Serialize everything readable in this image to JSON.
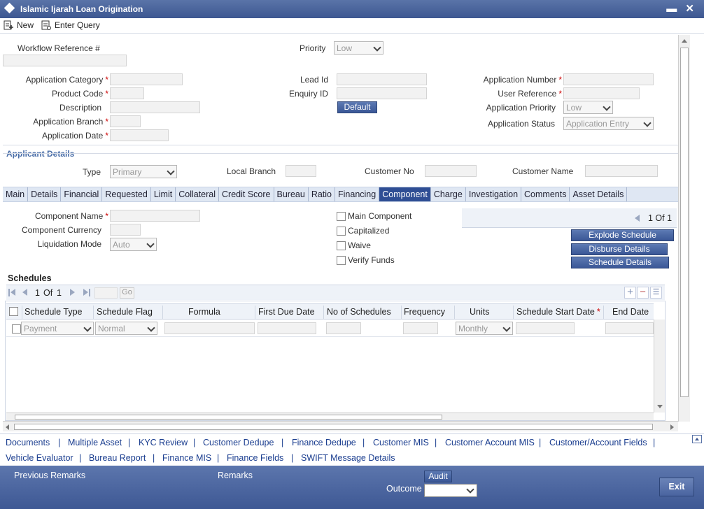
{
  "window": {
    "title": "Islamic Ijarah Loan Origination",
    "controls": "▬ ✕"
  },
  "toolbar": {
    "new": "New",
    "enter_query": "Enter Query"
  },
  "header": {
    "workflow_ref_label": "Workflow Reference #",
    "priority_label": "Priority",
    "priority_value": "Low",
    "app_category_label": "Application Category",
    "product_code_label": "Product Code",
    "description_label": "Description",
    "app_branch_label": "Application Branch",
    "app_date_label": "Application Date",
    "lead_id_label": "Lead Id",
    "enquiry_id_label": "Enquiry ID",
    "default_btn": "Default",
    "app_number_label": "Application Number",
    "user_ref_label": "User Reference",
    "app_priority_label": "Application Priority",
    "app_priority_value": "Low",
    "app_status_label": "Application Status",
    "app_status_value": "Application Entry",
    "required_mark": "*"
  },
  "applicant": {
    "section": "Applicant Details",
    "type_label": "Type",
    "type_value": "Primary",
    "local_branch_label": "Local Branch",
    "customer_no_label": "Customer No",
    "customer_name_label": "Customer Name"
  },
  "tabs": [
    "Main",
    "Details",
    "Financial",
    "Requested",
    "Limit",
    "Collateral",
    "Credit Score",
    "Bureau",
    "Ratio",
    "Financing",
    "Component",
    "Charge",
    "Investigation",
    "Comments",
    "Asset Details"
  ],
  "active_tab": "Component",
  "component": {
    "name_label": "Component Name",
    "currency_label": "Component Currency",
    "liq_mode_label": "Liquidation Mode",
    "liq_mode_value": "Auto",
    "main_component": "Main Component",
    "capitalized": "Capitalized",
    "waive": "Waive",
    "verify_funds": "Verify Funds",
    "pager": "1 Of 1",
    "explode": "Explode Schedule",
    "disburse": "Disburse Details",
    "schedule_details": "Schedule Details"
  },
  "schedules": {
    "title": "Schedules",
    "pager_num": "1",
    "pager_of": "Of",
    "pager_total": "1",
    "go": "Go",
    "columns": [
      "Schedule Type",
      "Schedule Flag",
      "Formula",
      "First Due Date",
      "No of Schedules",
      "Frequency",
      "Units",
      "Schedule Start Date",
      "End Date"
    ],
    "row": {
      "type": "Payment",
      "flag": "Normal",
      "units": "Monthly"
    }
  },
  "footer_links_row1": [
    "Documents",
    "Multiple Asset",
    "KYC Review",
    "Customer Dedupe",
    "Finance Dedupe",
    "Customer MIS",
    "Customer Account MIS",
    "Customer/Account Fields"
  ],
  "footer_links_row2": [
    "Vehicle Evaluator",
    "Bureau Report",
    "Finance MIS",
    "Finance Fields",
    "SWIFT Message Details"
  ],
  "bottom": {
    "prev_remarks": "Previous Remarks",
    "remarks": "Remarks",
    "audit": "Audit",
    "outcome": "Outcome",
    "exit": "Exit"
  }
}
